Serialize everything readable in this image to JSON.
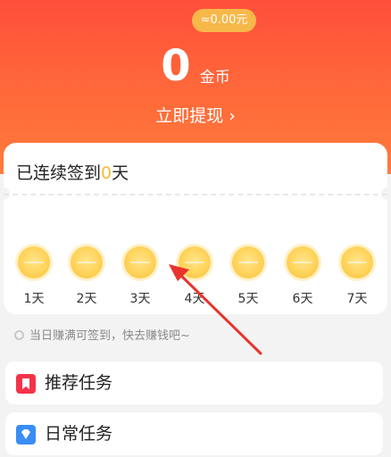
{
  "header": {
    "amount_pill": "≈0.00元",
    "coin_count": "0",
    "coin_unit": "金币",
    "withdraw_label": "立即提现",
    "withdraw_chevron": "›"
  },
  "checkin": {
    "title_prefix": "已连续签到",
    "streak": "0",
    "title_suffix": "天",
    "days": [
      {
        "label": "1天"
      },
      {
        "label": "2天"
      },
      {
        "label": "3天"
      },
      {
        "label": "4天"
      },
      {
        "label": "5天"
      },
      {
        "label": "6天"
      },
      {
        "label": "7天"
      }
    ]
  },
  "hint": {
    "text": "当日赚满可签到，快去赚钱吧~"
  },
  "tasks": [
    {
      "label": "推荐任务",
      "icon": "bookmark-icon",
      "color": "#f4334a"
    },
    {
      "label": "日常任务",
      "icon": "diamond-icon",
      "color": "#3a8cf6"
    }
  ],
  "colors": {
    "header_top": "#ff4f3b",
    "header_bottom": "#ff7a3c",
    "highlight": "#ffb838",
    "arrow": "#e8332b"
  }
}
